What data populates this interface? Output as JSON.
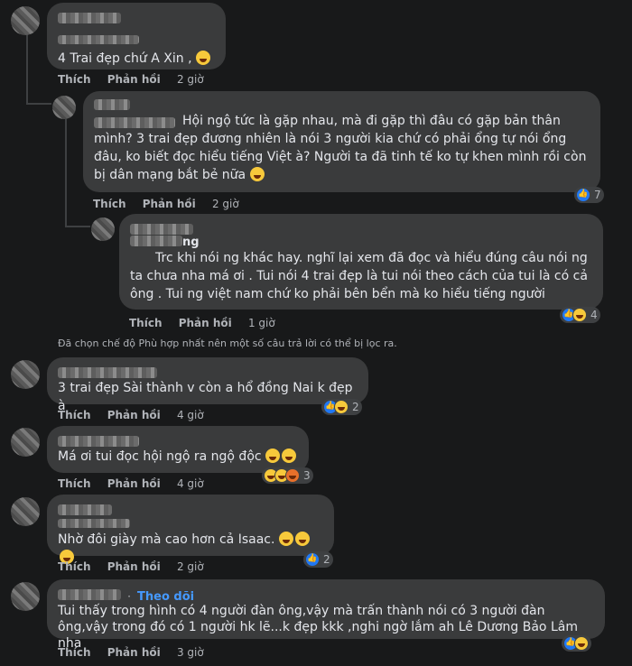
{
  "comments": [
    {
      "text": "4 Trai đẹp chứ A Xin ,",
      "like": "Thích",
      "reply": "Phản hồi",
      "time": "2 giờ"
    },
    {
      "text": "Hội ngộ tức là gặp nhau, mà đi gặp thì đâu có gặp bản thân mình? 3 trai đẹp đương nhiên là nói 3 người kia chứ có phải ổng tự nói ổng đâu, ko biết đọc hiểu tiếng Việt à? Người ta đã tinh tế ko tự khen mình rồi còn bị dân mạng bắt bẻ nữa",
      "like": "Thích",
      "reply": "Phản hồi",
      "time": "2 giờ",
      "reactions": "7"
    },
    {
      "name_suffix": "ng",
      "text": "Trc khi nói ng khác hay. nghĩ lại xem đã đọc và hiểu đúng câu nói ng ta chưa nha má ơi . Tui nói 4 trai đẹp là tui nói theo cách của tui là có cả ông . Tui ng việt nam chứ ko phải bên bển mà ko hiểu tiếng người",
      "like": "Thích",
      "reply": "Phản hồi",
      "time": "1 giờ",
      "reactions": "4"
    },
    {
      "text": "3 trai đẹp Sài thành v còn a hổ đồng Nai k đẹp à",
      "like": "Thích",
      "reply": "Phản hồi",
      "time": "4 giờ",
      "reactions": "2"
    },
    {
      "text": "Má ơi tui đọc hội ngộ ra ngộ độc",
      "like": "Thích",
      "reply": "Phản hồi",
      "time": "4 giờ",
      "reactions": "3"
    },
    {
      "text": "Nhờ đôi giày mà cao hơn cả Isaac.",
      "like": "Thích",
      "reply": "Phản hồi",
      "time": "2 giờ",
      "reactions": "2"
    },
    {
      "follow": "Theo dõi",
      "text": "Tui thấy trong hình có 4 người đàn ông,vậy mà trấn thành nói có 3 người đàn ông,vậy trong đó có 1 người hk lẽ...k đẹp kkk ,nghi ngờ lắm ah Lê Dương Bảo Lâm nha",
      "like": "Thích",
      "reply": "Phản hồi",
      "time": "3 giờ"
    }
  ],
  "filter_note": "Đã chọn chế độ Phù hợp nhất nên một số câu trả lời có thể bị lọc ra.",
  "colors": {
    "background": "#18191a",
    "bubble": "#3a3b3c",
    "link": "#4599ff"
  }
}
